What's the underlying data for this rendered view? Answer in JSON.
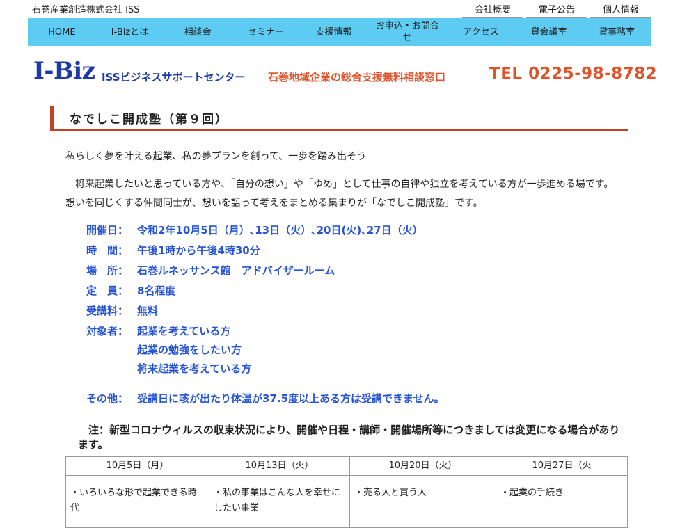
{
  "topbar": {
    "company": "石巻産業創造株式会社 ISS",
    "links": [
      "会社概要",
      "電子公告",
      "個人情報"
    ]
  },
  "nav": [
    "HOME",
    "I-Bizとは",
    "相談会",
    "セミナー",
    "支援情報",
    "お申込・お問合せ",
    "アクセス",
    "貸会議室",
    "貸事務室"
  ],
  "header": {
    "logo": "I-Biz",
    "center_name": "ISSビジネスサポートセンター",
    "tagline": "石巻地域企業の総合支援無料相談窓口",
    "tel": "TEL 0225-98-8782"
  },
  "page_title": "なでしこ開成塾（第９回）",
  "lead": "私らしく夢を叶える起業、私の夢プランを創って、一歩を踏み出そう",
  "body": "将来起業したいと思っている方や、「自分の想い」や「ゆめ」として仕事の自律や独立を考えている方が一歩進める場です。想いを同じくする仲間同士が、想いを語って考えをまとめる集まりが「なでしこ開成塾」です。",
  "info": {
    "date": {
      "label": "開催日：",
      "value": "令和2年10月5日（月）､13日（火）､20日(火)､27日（火）"
    },
    "time": {
      "label": "時　間：",
      "value": "午後1時から午後4時30分"
    },
    "place": {
      "label": "場　所：",
      "value": "石巻ルネッサンス館　アドバイザールーム"
    },
    "capacity": {
      "label": "定　員：",
      "value": "8名程度"
    },
    "fee": {
      "label": "受講料：",
      "value": "無料"
    },
    "target": {
      "label": "対象者：",
      "values": [
        "起業を考えている方",
        "起業の勉強をしたい方",
        "将来起業を考えている方"
      ]
    },
    "other": {
      "label": "その他：",
      "value": "受講日に咳が出たり体温が37.5度以上ある方は受講できません。"
    }
  },
  "note": "注：新型コロナウィルスの収束状況により、開催や日程・講師・開催場所等につきましては変更になる場合があります。",
  "schedule": {
    "headers": [
      "10月5日（月）",
      "10月13日（火）",
      "10月20日（火）",
      "10月27日（火"
    ],
    "cells": [
      "・いろいろな形で起業できる時代",
      "・私の事業はこんな人を幸せにしたい事業",
      "・売る人と買う人",
      "・起業の手続き"
    ]
  }
}
